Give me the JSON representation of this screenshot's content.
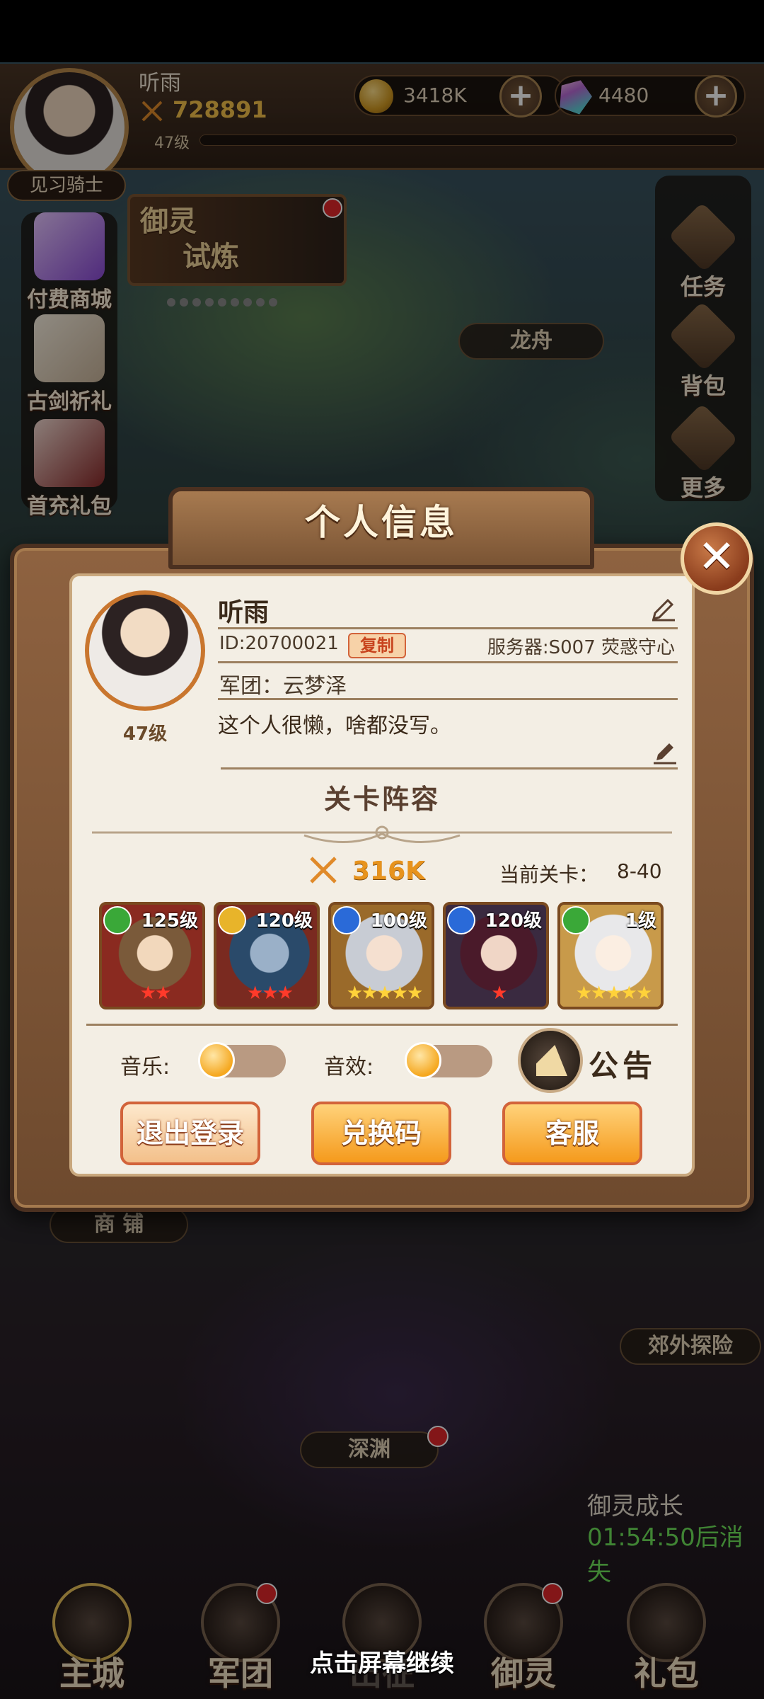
{
  "top": {
    "name": "听雨",
    "power": "728891",
    "level": "47级",
    "rank": "见习骑士",
    "gold": "3418K",
    "gems": "4480",
    "plus": "+"
  },
  "left_menu": [
    {
      "label": "付费商城"
    },
    {
      "label": "古剑祈礼"
    },
    {
      "label": "首充礼包"
    }
  ],
  "right_menu": [
    {
      "label": "任务"
    },
    {
      "label": "背包"
    },
    {
      "label": "更多"
    }
  ],
  "banner": {
    "title_line1": "御灵",
    "title_line2": "试炼"
  },
  "places": {
    "dragon_boat": "龙舟",
    "shop": "商 铺",
    "outskirts": "郊外探险",
    "abyss": "深渊"
  },
  "growth": {
    "title": "御灵成长",
    "timer": "01:54:50后消失"
  },
  "modal": {
    "title": "个人信息",
    "close": "✕",
    "name": "听雨",
    "level": "47级",
    "id": "ID:20700021",
    "copy": "复制",
    "server": "服务器:S007 荧惑守心",
    "guild": "军团：云梦泽",
    "signature": "这个人很懒，啥都没写。",
    "lineup_title": "关卡阵容",
    "power": "316K",
    "stage_label": "当前关卡：",
    "stage_value": "8-40",
    "heroes": [
      {
        "level": "125级",
        "stars": "★★",
        "element": "green",
        "frame": "red"
      },
      {
        "level": "120级",
        "stars": "★★★",
        "element": "gold",
        "frame": "red"
      },
      {
        "level": "100级",
        "stars": "★★★★★",
        "element": "blue",
        "frame": "gold"
      },
      {
        "level": "120级",
        "stars": "★",
        "element": "blue",
        "frame": "red"
      },
      {
        "level": "1级",
        "stars": "★★★★★",
        "element": "green",
        "frame": "gold"
      }
    ],
    "music_label": "音乐:",
    "sfx_label": "音效:",
    "notice": "公告",
    "logout": "退出登录",
    "redeem": "兑换码",
    "support": "客服"
  },
  "bottom_nav": [
    {
      "label": "主城"
    },
    {
      "label": "军团"
    },
    {
      "label": "出征"
    },
    {
      "label": "御灵"
    },
    {
      "label": "礼包"
    }
  ],
  "tap_hint": "点击屏幕继续"
}
